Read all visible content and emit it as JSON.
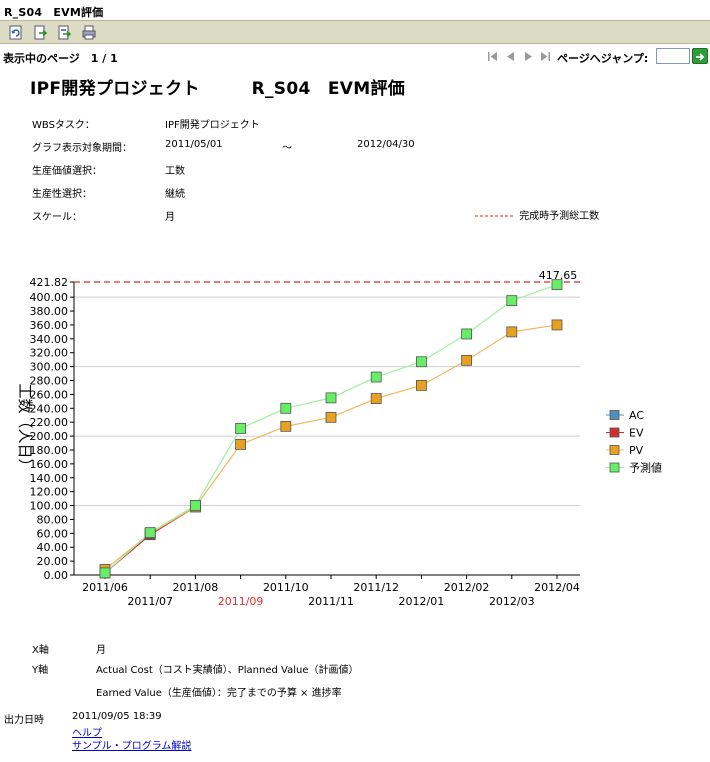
{
  "window": {
    "title": "R_S04　EVM評価"
  },
  "toolbar": {
    "icons": [
      "refresh-icon",
      "export-icon",
      "export-alt-icon",
      "print-icon"
    ]
  },
  "pager": {
    "info": "表示中のページ　1 / 1",
    "jump_label": "ページへジャンプ:",
    "jump_value": ""
  },
  "report": {
    "title": "IPF開発プロジェクト　　　R_S04　EVM評価",
    "params": [
      {
        "label": "WBSタスク：",
        "value": "IPF開発プロジェクト"
      },
      {
        "label": "グラフ表示対象期間：",
        "value": "2011/05/01",
        "tilde": "～",
        "value2": "2012/04/30"
      },
      {
        "label": "生産価値選択：",
        "value": "工数"
      },
      {
        "label": "生産性選択：",
        "value": "継続"
      },
      {
        "label": "スケール：",
        "value": "月"
      }
    ],
    "forecast_legend": "完成時予測総工数"
  },
  "chart_data": {
    "type": "line",
    "ylabel": "工数（人日）",
    "ylim": [
      0,
      421.82
    ],
    "yticks": [
      "0.00",
      "20.00",
      "40.00",
      "60.00",
      "80.00",
      "100.00",
      "120.00",
      "140.00",
      "160.00",
      "180.00",
      "200.00",
      "220.00",
      "240.00",
      "260.00",
      "280.00",
      "300.00",
      "320.00",
      "340.00",
      "360.00",
      "380.00",
      "400.00",
      "421.82"
    ],
    "x_top_labels": [
      "2011/06",
      "2011/08",
      "2011/10",
      "2011/12",
      "2012/02",
      "2012/04"
    ],
    "x_bottom_labels": [
      "2011/07",
      "2011/09",
      "2011/11",
      "2012/01",
      "2012/03"
    ],
    "highlight_label": "2011/09",
    "highlight_color": "#e03030",
    "reference_line": {
      "value": 421.82,
      "label": "417.65",
      "color": "#e05050"
    },
    "categories": [
      "2011/06",
      "2011/07",
      "2011/08",
      "2011/09",
      "2011/10",
      "2011/11",
      "2011/12",
      "2012/01",
      "2012/02",
      "2012/03",
      "2012/04"
    ],
    "series": [
      {
        "name": "AC",
        "color": "#4f8fbf",
        "values": [
          3,
          60,
          100
        ]
      },
      {
        "name": "EV",
        "color": "#d03030",
        "values": [
          3,
          58,
          98
        ]
      },
      {
        "name": "PV",
        "color": "#e8a020",
        "line": "#f0b860",
        "values": [
          8,
          60,
          98,
          188,
          214,
          227,
          254,
          273,
          309,
          350,
          360
        ]
      },
      {
        "name": "予測値",
        "color": "#66ee66",
        "line": "#a0f0a0",
        "values": [
          3,
          61,
          100,
          211,
          240,
          255,
          285,
          307,
          347,
          395,
          418
        ]
      }
    ]
  },
  "footer": {
    "x_axis_label": "X軸",
    "x_axis_value": "月",
    "y_axis_label": "Y軸",
    "y_axis_line1": "Actual Cost（コスト実績値）、Planned Value（計画値）",
    "y_axis_line2": "Earned Value（生産価値）：完了までの予算 × 進捗率",
    "output_label": "出力日時",
    "output_value": "2011/09/05 18:39",
    "link_help": "ヘルプ",
    "link_sample": "サンプル・プログラム解説"
  }
}
